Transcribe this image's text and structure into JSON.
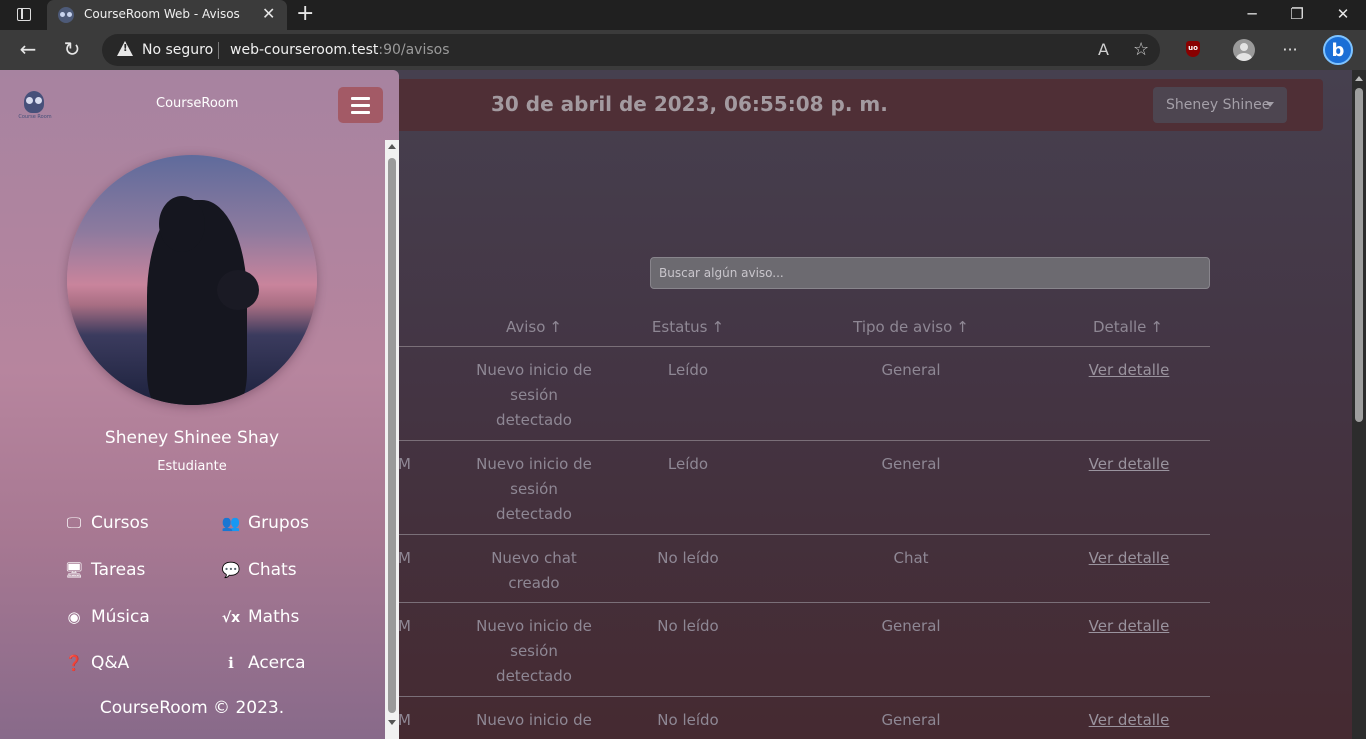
{
  "browser": {
    "tab_title": "CourseRoom Web - Avisos",
    "tab_close": "✕",
    "new_tab": "+",
    "security": "No seguro",
    "url_host": "web-courseroom.test",
    "url_rest": ":90/avisos",
    "read_aloud": "A",
    "favorites": "☆",
    "ublock": "uo",
    "more": "···",
    "bing": "b",
    "minimize": "─",
    "maximize": "❐",
    "close": "✕",
    "back": "←",
    "reload": "↻"
  },
  "header": {
    "datetime": "30 de abril de 2023, 06:55:08 p. m.",
    "user_menu": "Sheney Shinee"
  },
  "search": {
    "placeholder": "Buscar algún aviso..."
  },
  "table": {
    "columns": {
      "aviso": "Aviso",
      "estatus": "Estatus",
      "tipo": "Tipo de aviso",
      "detalle": "Detalle",
      "sort_glyph": "↑"
    },
    "rows": [
      {
        "frag": "",
        "aviso": "Nuevo inicio de sesión detectado",
        "estatus": "Leído",
        "tipo": "General",
        "detalle": "Ver detalle"
      },
      {
        "frag": "M",
        "aviso": "Nuevo inicio de sesión detectado",
        "estatus": "Leído",
        "tipo": "General",
        "detalle": "Ver detalle"
      },
      {
        "frag": "M",
        "aviso": "Nuevo chat creado",
        "estatus": "No leído",
        "tipo": "Chat",
        "detalle": "Ver detalle"
      },
      {
        "frag": "M",
        "aviso": "Nuevo inicio de sesión detectado",
        "estatus": "No leído",
        "tipo": "General",
        "detalle": "Ver detalle"
      },
      {
        "frag": "M",
        "aviso": "Nuevo inicio de",
        "estatus": "No leído",
        "tipo": "General",
        "detalle": "Ver detalle"
      }
    ]
  },
  "sidebar": {
    "logo_text": "Course Room",
    "brand": "CourseRoom",
    "user_name": "Sheney Shinee Shay",
    "user_role": "Estudiante",
    "menu": {
      "cursos": {
        "label": "Cursos",
        "icon": "🖵"
      },
      "grupos": {
        "label": "Grupos",
        "icon": "👥"
      },
      "tareas": {
        "label": "Tareas",
        "icon": "🖥"
      },
      "chats": {
        "label": "Chats",
        "icon": "💬"
      },
      "musica": {
        "label": "Música",
        "icon": "◉"
      },
      "maths": {
        "label": "Maths",
        "icon": "√x"
      },
      "qa": {
        "label": "Q&A",
        "icon": "❓"
      },
      "acerca": {
        "label": "Acerca",
        "icon": "ℹ"
      }
    },
    "footer": "CourseRoom © 2023."
  }
}
